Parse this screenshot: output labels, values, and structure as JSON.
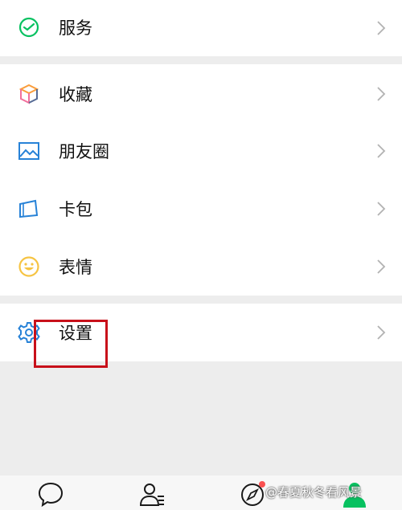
{
  "menu": {
    "items": [
      {
        "label": "服务",
        "icon": "service-icon"
      },
      {
        "label": "收藏",
        "icon": "favorites-cube-icon"
      },
      {
        "label": "朋友圈",
        "icon": "moments-photo-icon"
      },
      {
        "label": "卡包",
        "icon": "card-wallet-icon"
      },
      {
        "label": "表情",
        "icon": "emoji-smile-icon"
      },
      {
        "label": "设置",
        "icon": "gear-icon"
      }
    ]
  },
  "tabbar": {
    "tabs": [
      "chat-icon",
      "contacts-icon",
      "discover-compass-icon",
      "me-icon"
    ],
    "badge_color": "#fa5151"
  },
  "watermark": {
    "text": "@春夏秋冬看风景"
  },
  "colors": {
    "wechat_green": "#07c160",
    "highlight_red": "#c8101a"
  }
}
